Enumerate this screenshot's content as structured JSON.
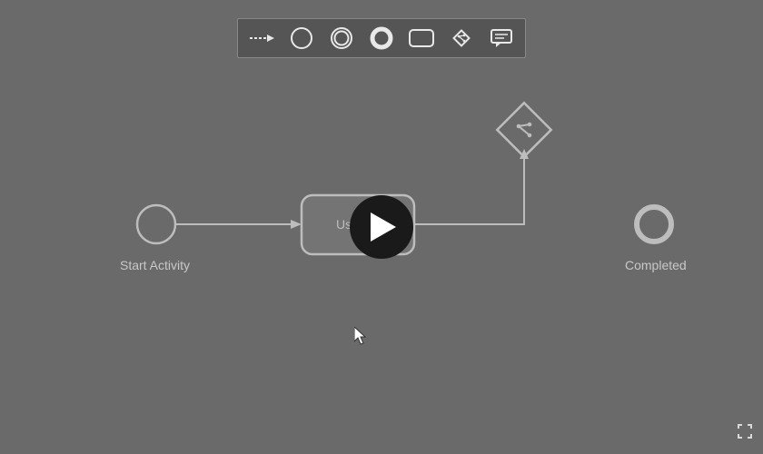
{
  "toolbar": {
    "tools": [
      {
        "name": "connector-tool"
      },
      {
        "name": "start-event-tool"
      },
      {
        "name": "intermediate-event-tool"
      },
      {
        "name": "end-event-tool",
        "selected": true
      },
      {
        "name": "task-tool"
      },
      {
        "name": "gateway-tool"
      },
      {
        "name": "annotation-tool"
      }
    ]
  },
  "nodes": {
    "start": {
      "label": "Start Activity"
    },
    "task": {
      "label": "User Task"
    },
    "end": {
      "label": "Completed"
    }
  },
  "overlay": {
    "play_label": "Play"
  }
}
